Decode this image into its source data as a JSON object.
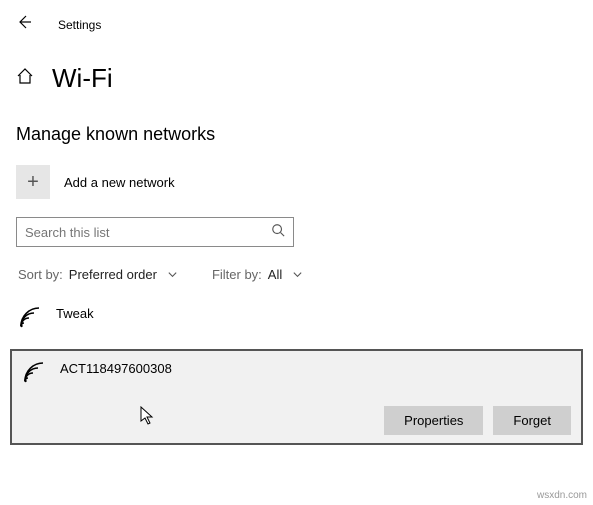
{
  "header": {
    "title": "Settings"
  },
  "page": {
    "title": "Wi-Fi",
    "subtitle": "Manage known networks"
  },
  "add": {
    "label": "Add a new network"
  },
  "search": {
    "placeholder": "Search this list"
  },
  "sort": {
    "label": "Sort by:",
    "value": "Preferred order"
  },
  "filter": {
    "label": "Filter by:",
    "value": "All"
  },
  "networks": [
    {
      "name": "Tweak"
    },
    {
      "name": "ACT118497600308"
    }
  ],
  "actions": {
    "properties": "Properties",
    "forget": "Forget"
  },
  "watermark": "wsxdn.com"
}
